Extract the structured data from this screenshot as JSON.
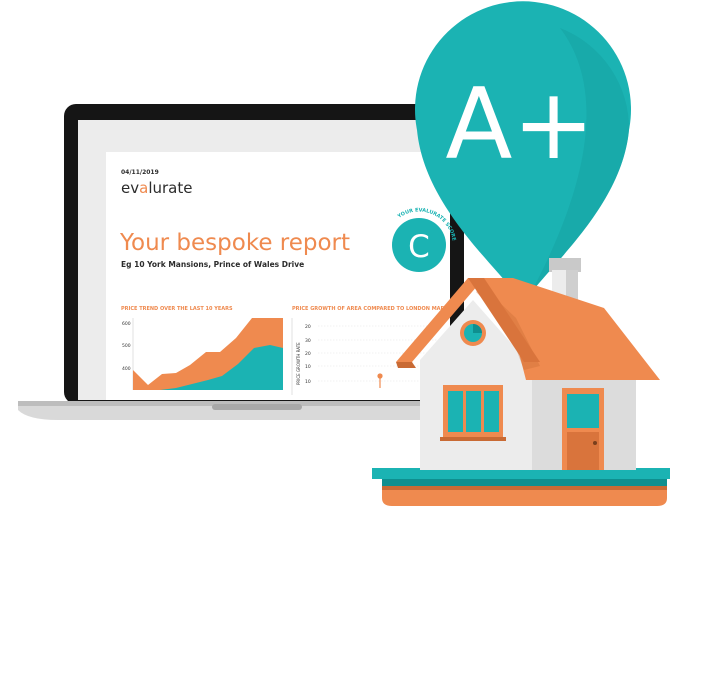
{
  "report": {
    "date": "04/11/2019",
    "brand_prefix": "ev",
    "brand_accent": "a",
    "brand_suffix": "lurate",
    "title": "Your bespoke report",
    "address": "Eg 10 York Mansions, Prince of Wales Drive",
    "score_badge_label": "YOUR EVALURATE SCORE",
    "score_letter": "C",
    "chart_left_title": "PRICE TREND OVER THE LAST 10 YEARS",
    "chart_left_ticks": [
      "600",
      "500",
      "400"
    ],
    "chart_right_title": "PRICE GROWTH OF AREA COMPARED TO LONDON MARKET",
    "chart_right_ylabel": "PRICE GROWTH RATE",
    "chart_right_ticks": [
      "20",
      "30",
      "20",
      "10",
      "10"
    ]
  },
  "pin": {
    "grade": "A+"
  },
  "colors": {
    "orange": "#ef8a4f",
    "teal": "#1bb3b3",
    "dark": "#2c2c2c"
  },
  "icons": [
    "laptop-icon",
    "location-pin-icon",
    "house-icon"
  ]
}
